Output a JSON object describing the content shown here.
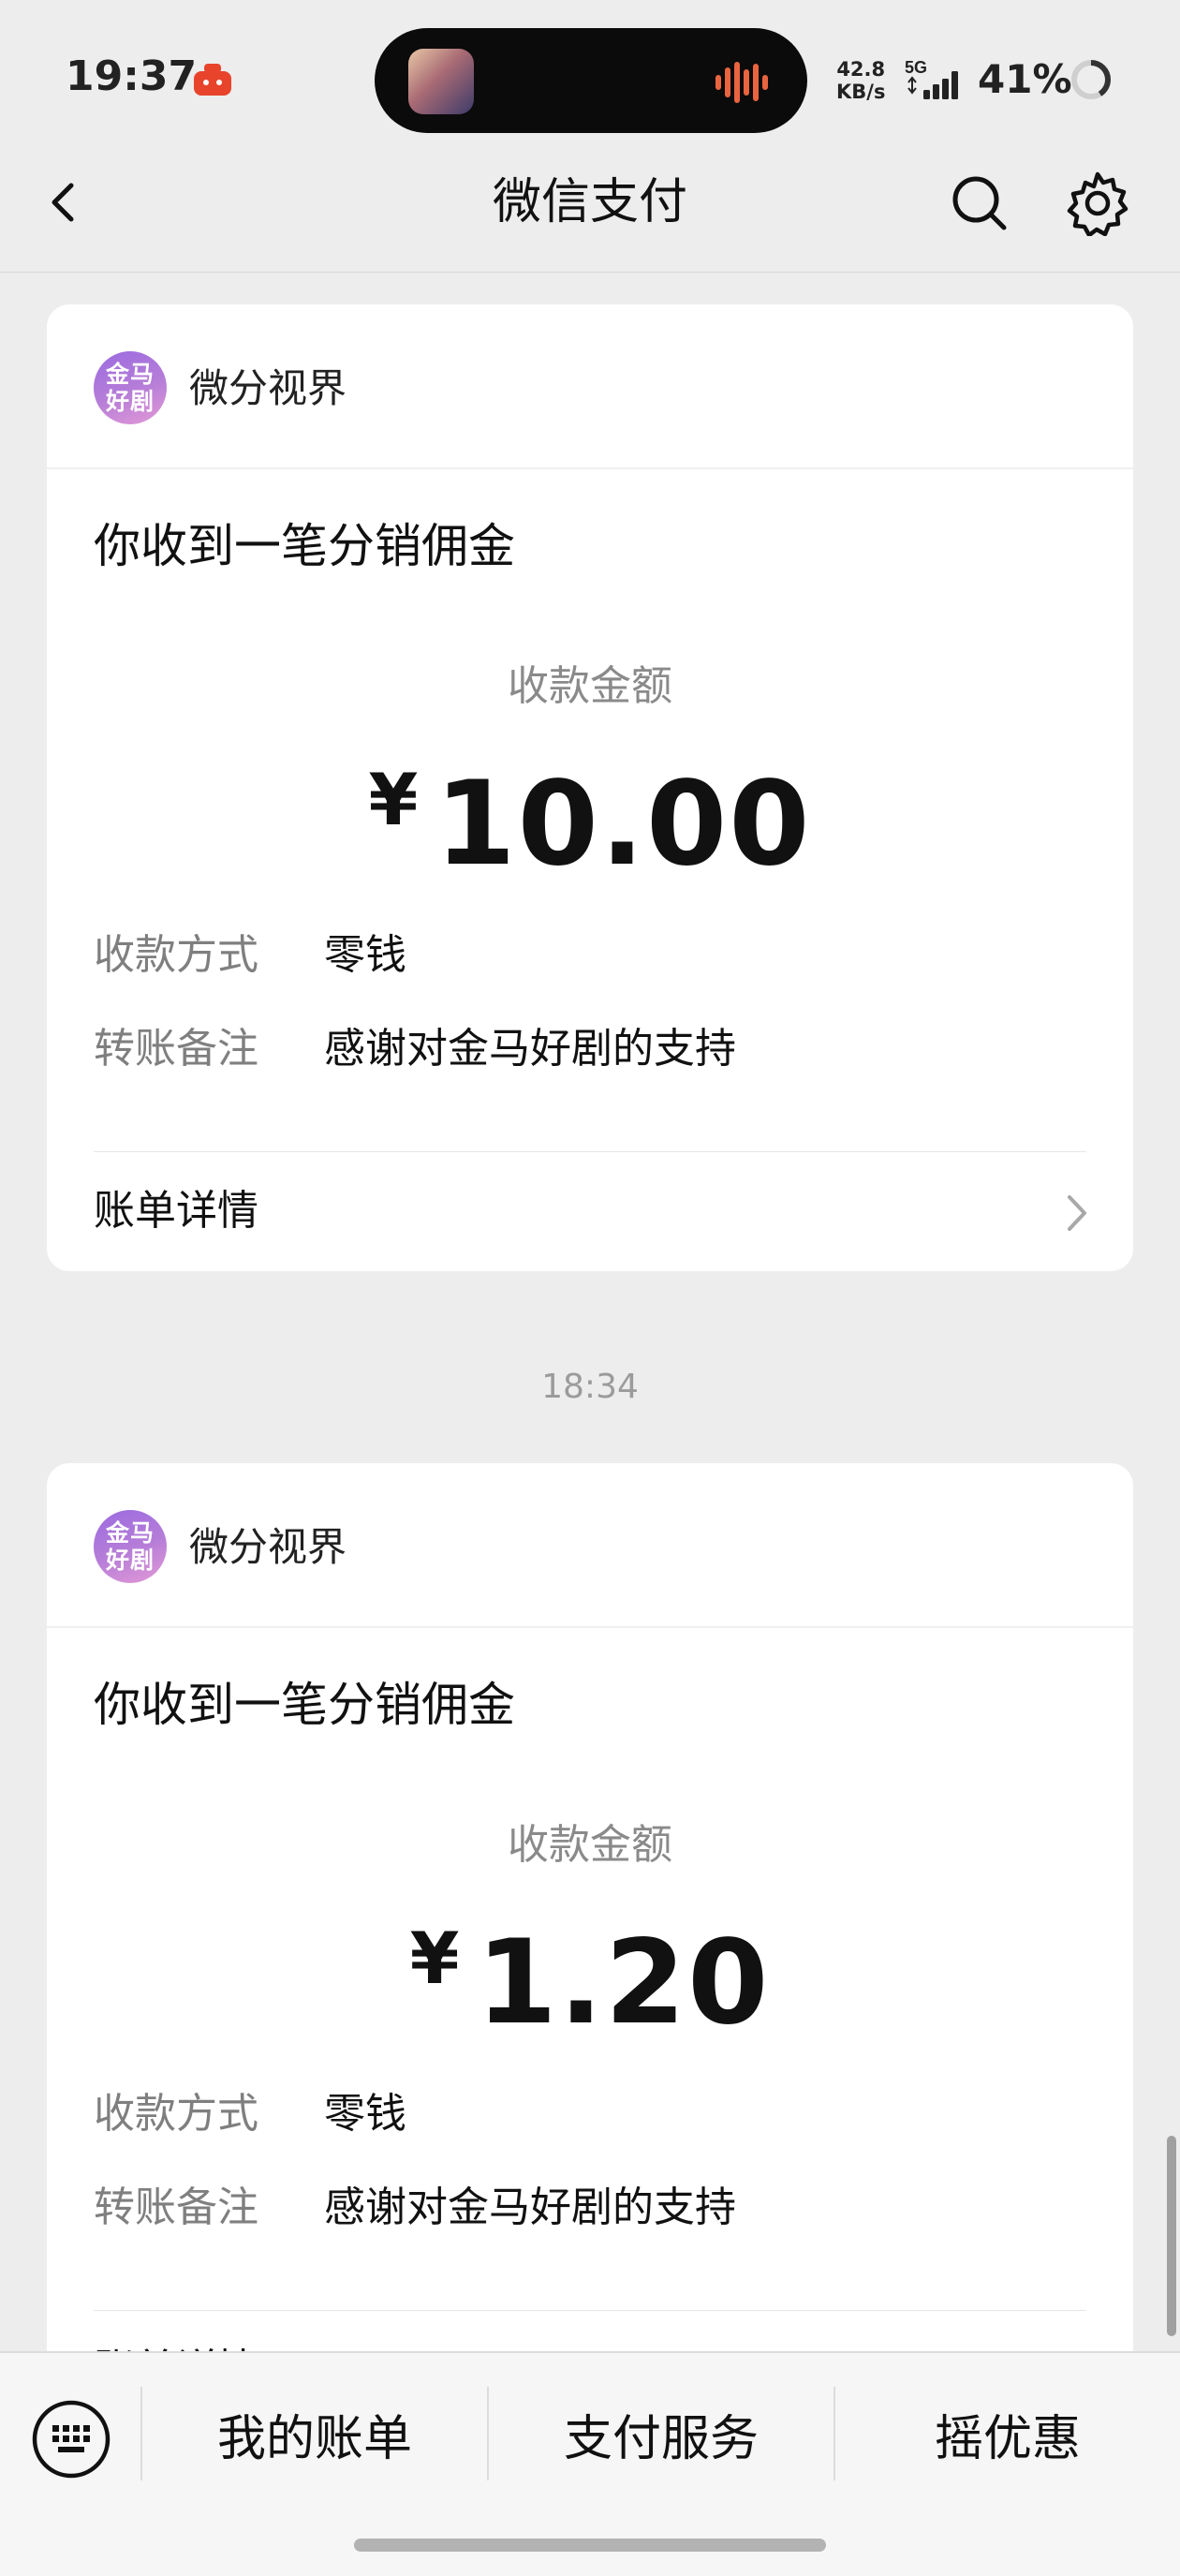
{
  "status_bar": {
    "time": "19:37",
    "network_speed_value": "42.8",
    "network_speed_unit": "KB/s",
    "network_type": "5G",
    "battery_percent": "41%"
  },
  "header": {
    "title": "微信支付",
    "back_icon": "chevron-left-icon",
    "search_icon": "search-icon",
    "settings_icon": "gear-icon"
  },
  "messages": [
    {
      "sender_avatar_line1": "金马",
      "sender_avatar_line2": "好剧",
      "sender_name": "微分视界",
      "title": "你收到一笔分销佣金",
      "amount_label": "收款金额",
      "currency": "¥",
      "amount": "10.00",
      "method_label": "收款方式",
      "method_value": "零钱",
      "note_label": "转账备注",
      "note_value": "感谢对金马好剧的支持",
      "bill_link": "账单详情"
    },
    {
      "timestamp": "18:34",
      "sender_avatar_line1": "金马",
      "sender_avatar_line2": "好剧",
      "sender_name": "微分视界",
      "title": "你收到一笔分销佣金",
      "amount_label": "收款金额",
      "currency": "¥",
      "amount": "1.20",
      "method_label": "收款方式",
      "method_value": "零钱",
      "note_label": "转账备注",
      "note_value": "感谢对金马好剧的支持",
      "bill_link": "账单详情"
    }
  ],
  "bottom_menu": {
    "keyboard_icon": "keyboard-icon",
    "items": [
      "我的账单",
      "支付服务",
      "摇优惠"
    ]
  },
  "colors": {
    "background": "#ededed",
    "card": "#ffffff",
    "avatar_gradient": [
      "#9b6be0",
      "#e39ad6"
    ],
    "muted_text": "#8a8a8a",
    "island_accent": "#e9643f"
  }
}
